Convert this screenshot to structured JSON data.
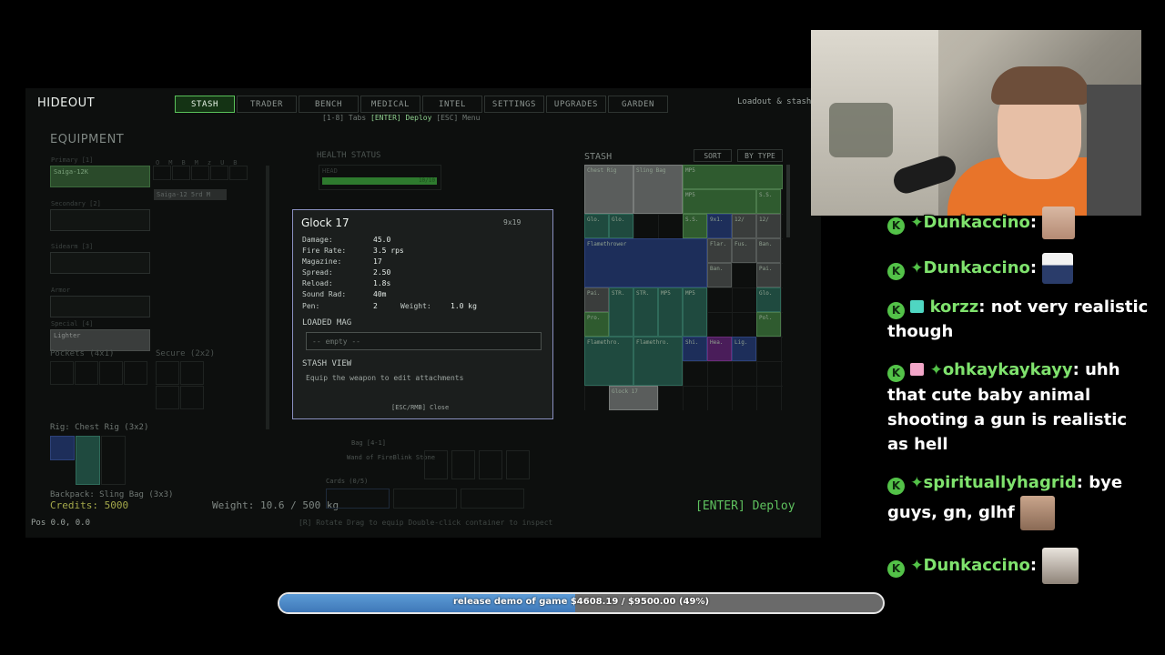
{
  "game": {
    "title": "HIDEOUT",
    "tabs": [
      "STASH",
      "TRADER",
      "BENCH",
      "MEDICAL",
      "INTEL",
      "SETTINGS",
      "UPGRADES",
      "GARDEN"
    ],
    "active_tab": "STASH",
    "loadout_label": "Loadout & stash",
    "hint_prefix": "[1-8] Tabs",
    "hint_deploy": "[ENTER] Deploy",
    "hint_suffix": "[ESC] Menu",
    "equipment_title": "EQUIPMENT",
    "slots": {
      "primary_label": "Primary [1]",
      "primary_value": "Saiga-12K",
      "secondary_label": "Secondary [2]",
      "sidearm_label": "Sidearm [3]",
      "armor_label": "Armor",
      "special_label": "Special [4]",
      "special_value": "Lighter",
      "pockets_label": "Pockets (4x1)",
      "secure_label": "Secure (2x2)",
      "rig_label": "Rig: Chest Rig (3x2)",
      "backpack_label": "Backpack: Sling Bag (3x3)",
      "attachment_value": "Saiga-12 5rd M"
    },
    "attach_headers": [
      "O",
      "M",
      "B",
      "Mz",
      "UB"
    ],
    "credits": "Credits: 5000",
    "pos": "Pos 0.0, 0.0",
    "weight": "Weight: 10.6 / 500 kg",
    "deploy": "[ENTER] Deploy",
    "footer_hints": "[R] Rotate      Drag to equip      Double-click container to inspect",
    "health_title": "HEALTH STATUS",
    "health_head": "HEAD",
    "health_head_value": "10/10",
    "stash_title": "STASH",
    "sort_label": "SORT",
    "bytype_label": "BY TYPE",
    "stash_items": [
      "Chest Rig",
      "Sling Bag",
      "MP5",
      "MP5",
      "S.S.",
      "Glo.",
      "Glo.",
      "S.S.",
      "9x1.",
      "12/",
      "12/",
      "Flamethrower",
      "Flar.",
      "Fus.",
      "Ban.",
      "Ban.",
      "Pai.",
      "Pai.",
      "STR.",
      "STR.",
      "MP5",
      "MP5",
      "Glo.",
      "Pro.",
      "Pol.",
      "Flamethro.",
      "Flamethro.",
      "Shi.",
      "Hea.",
      "Lig.",
      "Glock 17"
    ],
    "bag_label": "Bag [4-1]",
    "wand_label": "Wand of FireBlink Stone",
    "cards_label": "Cards (0/5)"
  },
  "tooltip": {
    "name": "Glock 17",
    "size": "9x19",
    "stats": [
      {
        "label": "Damage:",
        "value": "45.0"
      },
      {
        "label": "Fire Rate:",
        "value": "3.5 rps"
      },
      {
        "label": "Magazine:",
        "value": "17"
      },
      {
        "label": "Spread:",
        "value": "2.50"
      },
      {
        "label": "Reload:",
        "value": "1.8s"
      },
      {
        "label": "Sound Rad:",
        "value": "40m"
      },
      {
        "label": "Pen:",
        "value": "2"
      }
    ],
    "weight_label": "Weight:",
    "weight_value": "1.0 kg",
    "loaded_mag_title": "LOADED MAG",
    "mag_empty": "-- empty --",
    "stash_view_title": "STASH VIEW",
    "stash_view_hint": "Equip the weapon to edit attachments",
    "close_hint": "[ESC/RMB] Close"
  },
  "chat": [
    {
      "user": "Dunkaccino",
      "text": "",
      "badges": [
        "k",
        "diamond"
      ],
      "emote": "face-emote"
    },
    {
      "user": "Dunkaccino",
      "text": "",
      "badges": [
        "k",
        "diamond"
      ],
      "emote": "dancing-man-emote"
    },
    {
      "user": "korzz",
      "text": "not very realistic though",
      "badges": [
        "k",
        "gift-teal"
      ]
    },
    {
      "user": "ohkaykaykayy",
      "text": "uhh that cute baby animal shooting a gun is realistic as hell",
      "badges": [
        "k",
        "gift-pink",
        "diamond"
      ]
    },
    {
      "user": "spirituallyhagrid",
      "text": "bye guys, gn, glhf",
      "badges": [
        "k",
        "diamond"
      ],
      "emote": "face-emote"
    },
    {
      "user": "Dunkaccino",
      "text": "",
      "badges": [
        "k",
        "diamond"
      ],
      "emote": "animal-emote"
    }
  ],
  "goal": {
    "text": "release demo of game $4608.19 / $9500.00 (49%)",
    "progress_pct": 49,
    "fill_color": "#4a88c8"
  }
}
